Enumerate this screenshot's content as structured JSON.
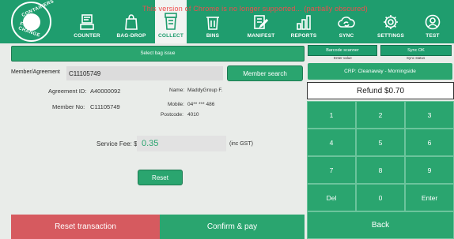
{
  "colors": {
    "brand_green": "#1f9d6e",
    "button_green": "#2aa56f",
    "reset_red": "#d65a5f",
    "fee_text": "#2aa56f",
    "watermark_red": "#f04d4d"
  },
  "header": {
    "logo_text_top": "CONTAINERS",
    "logo_text_bottom": "FOR CHANGE",
    "watermark": "This version of Chrome is no longer supported... (partially obscured)",
    "nav": [
      {
        "label": "COUNTER",
        "icon": "counter-icon"
      },
      {
        "label": "BAG-DROP",
        "icon": "bag-icon"
      },
      {
        "label": "COLLECT",
        "icon": "collect-bin-icon",
        "active": true
      },
      {
        "label": "BINS",
        "icon": "trash-bin-icon"
      },
      {
        "label": "MANIFEST",
        "icon": "manifest-edit-icon"
      },
      {
        "label": "REPORTS",
        "icon": "bar-chart-icon"
      },
      {
        "label": "SYNC",
        "icon": "cloud-sync-icon"
      },
      {
        "label": "SETTINGS",
        "icon": "gear-icon"
      },
      {
        "label": "TEST",
        "icon": "user-icon"
      }
    ]
  },
  "left": {
    "select_bag_issue": "Select bag issue",
    "member_label": "Member/Agreement",
    "member_value": "C11105749",
    "member_search": "Member search",
    "agreement_id_label": "Agreement ID:",
    "agreement_id_value": "A40000092",
    "member_no_label": "Member No:",
    "member_no_value": "C11105749",
    "name_label": "Name:",
    "name_value": "MaddyGroup F.",
    "mobile_label": "Mobile:",
    "mobile_value": "04** *** 486",
    "postcode_label": "Postcode:",
    "postcode_value": "4010",
    "service_fee_label": "Service Fee: $",
    "service_fee_value": "0.35",
    "service_fee_unit": "(inc GST)",
    "reset": "Reset",
    "reset_transaction": "Reset transaction",
    "confirm_pay": "Confirm & pay"
  },
  "right": {
    "scanner_btn": "Barcode scanner",
    "scanner_sub": "Enter value",
    "sync_btn": "Sync OK",
    "sync_sub": "Sync status",
    "crp": "CRP: Cleanaway - Morningside",
    "refund": "Refund $0.70",
    "keys": [
      "1",
      "2",
      "3",
      "4",
      "5",
      "6",
      "7",
      "8",
      "9",
      "Del",
      "0",
      "Enter"
    ],
    "back": "Back"
  }
}
